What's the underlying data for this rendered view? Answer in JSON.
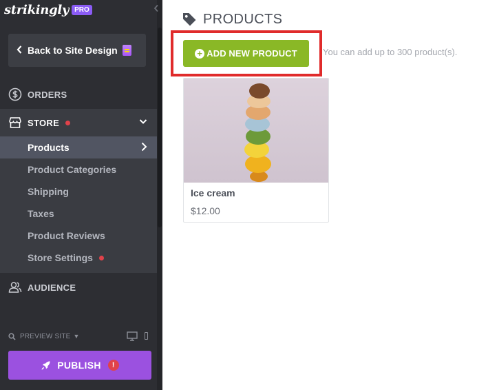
{
  "brand": {
    "logo_text": "strikingly",
    "badge": "PRO",
    "badge_color": "#8b5cf6"
  },
  "sidebar": {
    "back_button_label": "Back to Site Design",
    "sections": {
      "orders": {
        "label": "ORDERS",
        "icon": "dollar-circle-icon"
      },
      "store": {
        "label": "STORE",
        "icon": "storefront-icon",
        "has_alert_dot": true
      },
      "audience": {
        "label": "AUDIENCE",
        "icon": "people-icon"
      }
    },
    "store_items": [
      {
        "label": "Products",
        "active": true
      },
      {
        "label": "Product Categories"
      },
      {
        "label": "Shipping"
      },
      {
        "label": "Taxes"
      },
      {
        "label": "Product Reviews"
      },
      {
        "label": "Store Settings",
        "has_alert_dot": true
      }
    ],
    "preview_label": "PREVIEW SITE",
    "publish_label": "PUBLISH",
    "publish_alert": "!",
    "publish_color": "#9b51e0"
  },
  "main": {
    "title": "PRODUCTS",
    "add_button_label": "ADD NEW PRODUCT",
    "add_button_color": "#8ab826",
    "hint": "You can add up to 300 product(s).",
    "products": [
      {
        "name": "Ice cream",
        "price": "$12.00",
        "image": "ice-cream-scoops-stack"
      }
    ]
  }
}
